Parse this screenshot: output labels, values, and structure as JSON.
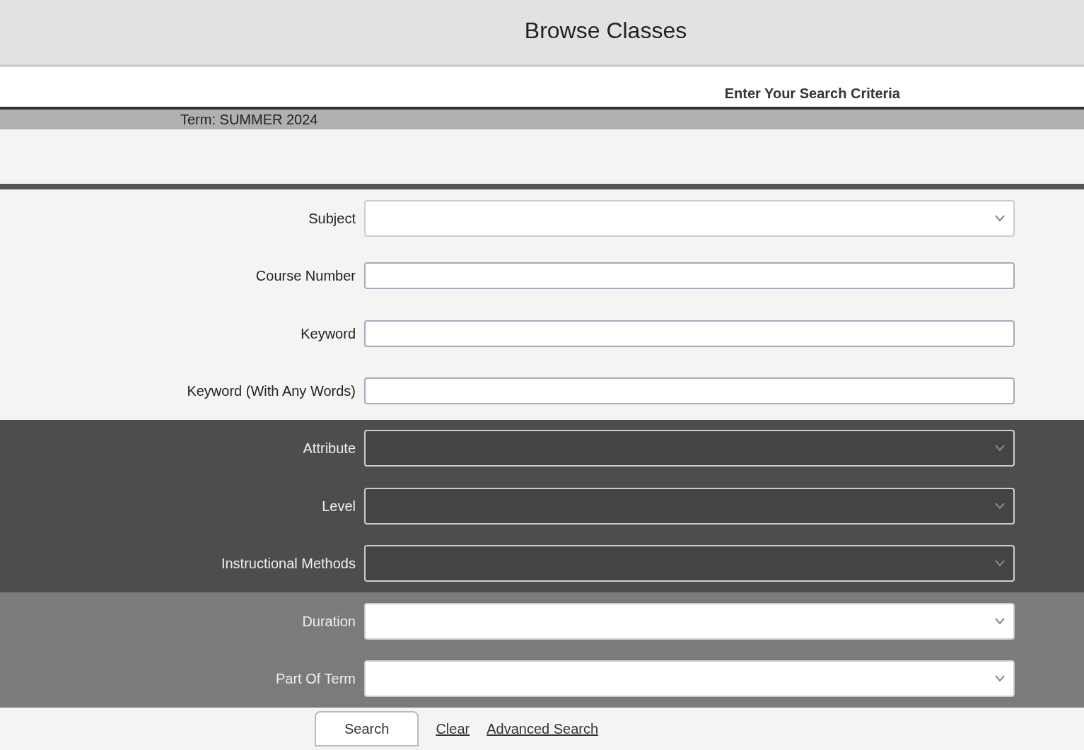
{
  "header": {
    "title": "Browse Classes"
  },
  "section": {
    "heading": "Enter Your Search Criteria",
    "term": "Term: SUMMER 2024"
  },
  "fields": [
    {
      "label": "Subject",
      "kind": "select"
    },
    {
      "label": "Course Number",
      "kind": "text"
    },
    {
      "label": "Keyword",
      "kind": "text"
    },
    {
      "label": "Keyword (With Any Words)",
      "kind": "text"
    },
    {
      "label": "Attribute",
      "kind": "select"
    },
    {
      "label": "Level",
      "kind": "select"
    },
    {
      "label": "Instructional Methods",
      "kind": "select"
    },
    {
      "label": "Duration",
      "kind": "select"
    },
    {
      "label": "Part Of Term",
      "kind": "select"
    }
  ],
  "buttons": [
    {
      "label": "Search",
      "kind": "primary"
    },
    {
      "label": "Clear",
      "kind": "link"
    },
    {
      "label": "Advanced Search",
      "kind": "link"
    }
  ]
}
